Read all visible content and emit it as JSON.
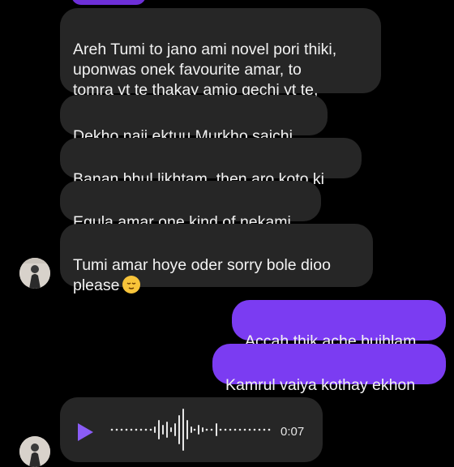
{
  "conversation": {
    "incoming_messages": [
      {
        "text": "Areh Tumi to jano ami novel pori thiki,\nuponwas onek favourite amar, to\ntomra yt te thakay amio gechi yt te,"
      },
      {
        "text": "Dekho naii ektuu Murkho sajchi"
      },
      {
        "text": "Banan bhul likhtam, then aro koto ki"
      },
      {
        "text": "Egula amar one kind of nekami"
      },
      {
        "text": "Tumi amar hoye oder sorry bole dioo\nplease",
        "emoji": "relieved-face-icon"
      }
    ],
    "outgoing_messages": [
      {
        "text": "Accah thik ache bujhlam"
      },
      {
        "text": "Kamrul vaiya kothay ekhon"
      }
    ],
    "voice_message": {
      "duration": "0:07",
      "icon": "play-icon"
    }
  },
  "colors": {
    "background": "#000000",
    "incoming_bubble": "#262626",
    "outgoing_bubble": "#7b3cf2",
    "play_accent": "#8a5cf6"
  }
}
